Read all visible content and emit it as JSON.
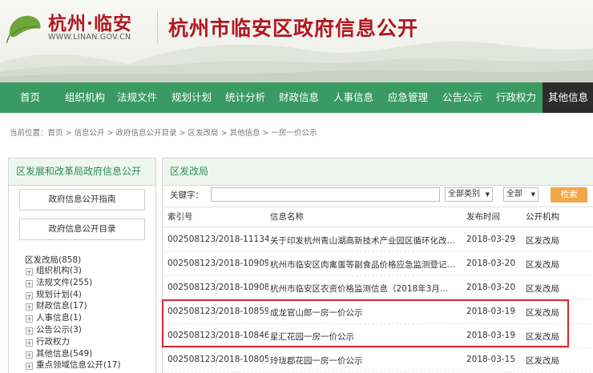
{
  "header": {
    "logo_text": "杭州·临安",
    "logo_url": "WWW.LINAN.GOV.CN",
    "site_title": "杭州市临安区政府信息公开"
  },
  "nav": [
    {
      "label": "首页"
    },
    {
      "label": "组织机构"
    },
    {
      "label": "法规文件"
    },
    {
      "label": "规划计划"
    },
    {
      "label": "统计分析"
    },
    {
      "label": "财政信息"
    },
    {
      "label": "人事信息"
    },
    {
      "label": "应急管理"
    },
    {
      "label": "公告公示"
    },
    {
      "label": "行政权力"
    },
    {
      "label": "其他信息"
    }
  ],
  "breadcrumb": "当前位置：首页 > 信息公开 > 政府信息公开目录 > 区发改局 > 其他信息 > 一房一价公示",
  "left": {
    "title": "区发展和改革局政府信息公开",
    "btn_guide": "政府信息公开指南",
    "btn_catalog": "政府信息公开目录",
    "tree_root": "区发改局(858)",
    "tree": [
      "组织机构(3)",
      "法规文件(255)",
      "规划计划(4)",
      "财政信息(17)",
      "人事信息(1)",
      "公告公示(3)",
      "行政权力",
      "其他信息(549)",
      "重点领域信息公开(17)"
    ]
  },
  "right": {
    "title": "区发改局",
    "keyword_label": "关键字：",
    "keyword_value": "",
    "category_select": "全部类别",
    "scope_select": "全部",
    "search_btn": "检索",
    "columns": [
      "索引号",
      "信息名称",
      "发布时间",
      "公开机构"
    ],
    "rows": [
      [
        "002508123/2018-11134",
        "关于印发杭州青山湖高新技术产业园区循环化改造...",
        "2018-03-29",
        "区发改局"
      ],
      [
        "002508123/2018-10909",
        "杭州市临安区肉禽蛋等副食品价格应急监测登记表...",
        "2018-03-20",
        "区发改局"
      ],
      [
        "002508123/2018-10908",
        "杭州市临安区农资价格监测信息（2018年3月...",
        "2018-03-20",
        "区发改局"
      ],
      [
        "002508123/2018-10859",
        "成龙官山郎一房一价公示",
        "2018-03-19",
        "区发改局"
      ],
      [
        "002508123/2018-10846",
        "星汇花园一房一价公示",
        "2018-03-19",
        "区发改局"
      ],
      [
        "002508123/2018-10805",
        "玲珑郡花园一房一价公示",
        "2018-03-15",
        "区发改局"
      ]
    ]
  },
  "colors": {
    "brand_red": "#b01820",
    "nav_green": "#3a9a63",
    "nav_active": "#2c2c2c",
    "search_orange": "#f0a64a",
    "highlight_red": "#d9272e"
  }
}
